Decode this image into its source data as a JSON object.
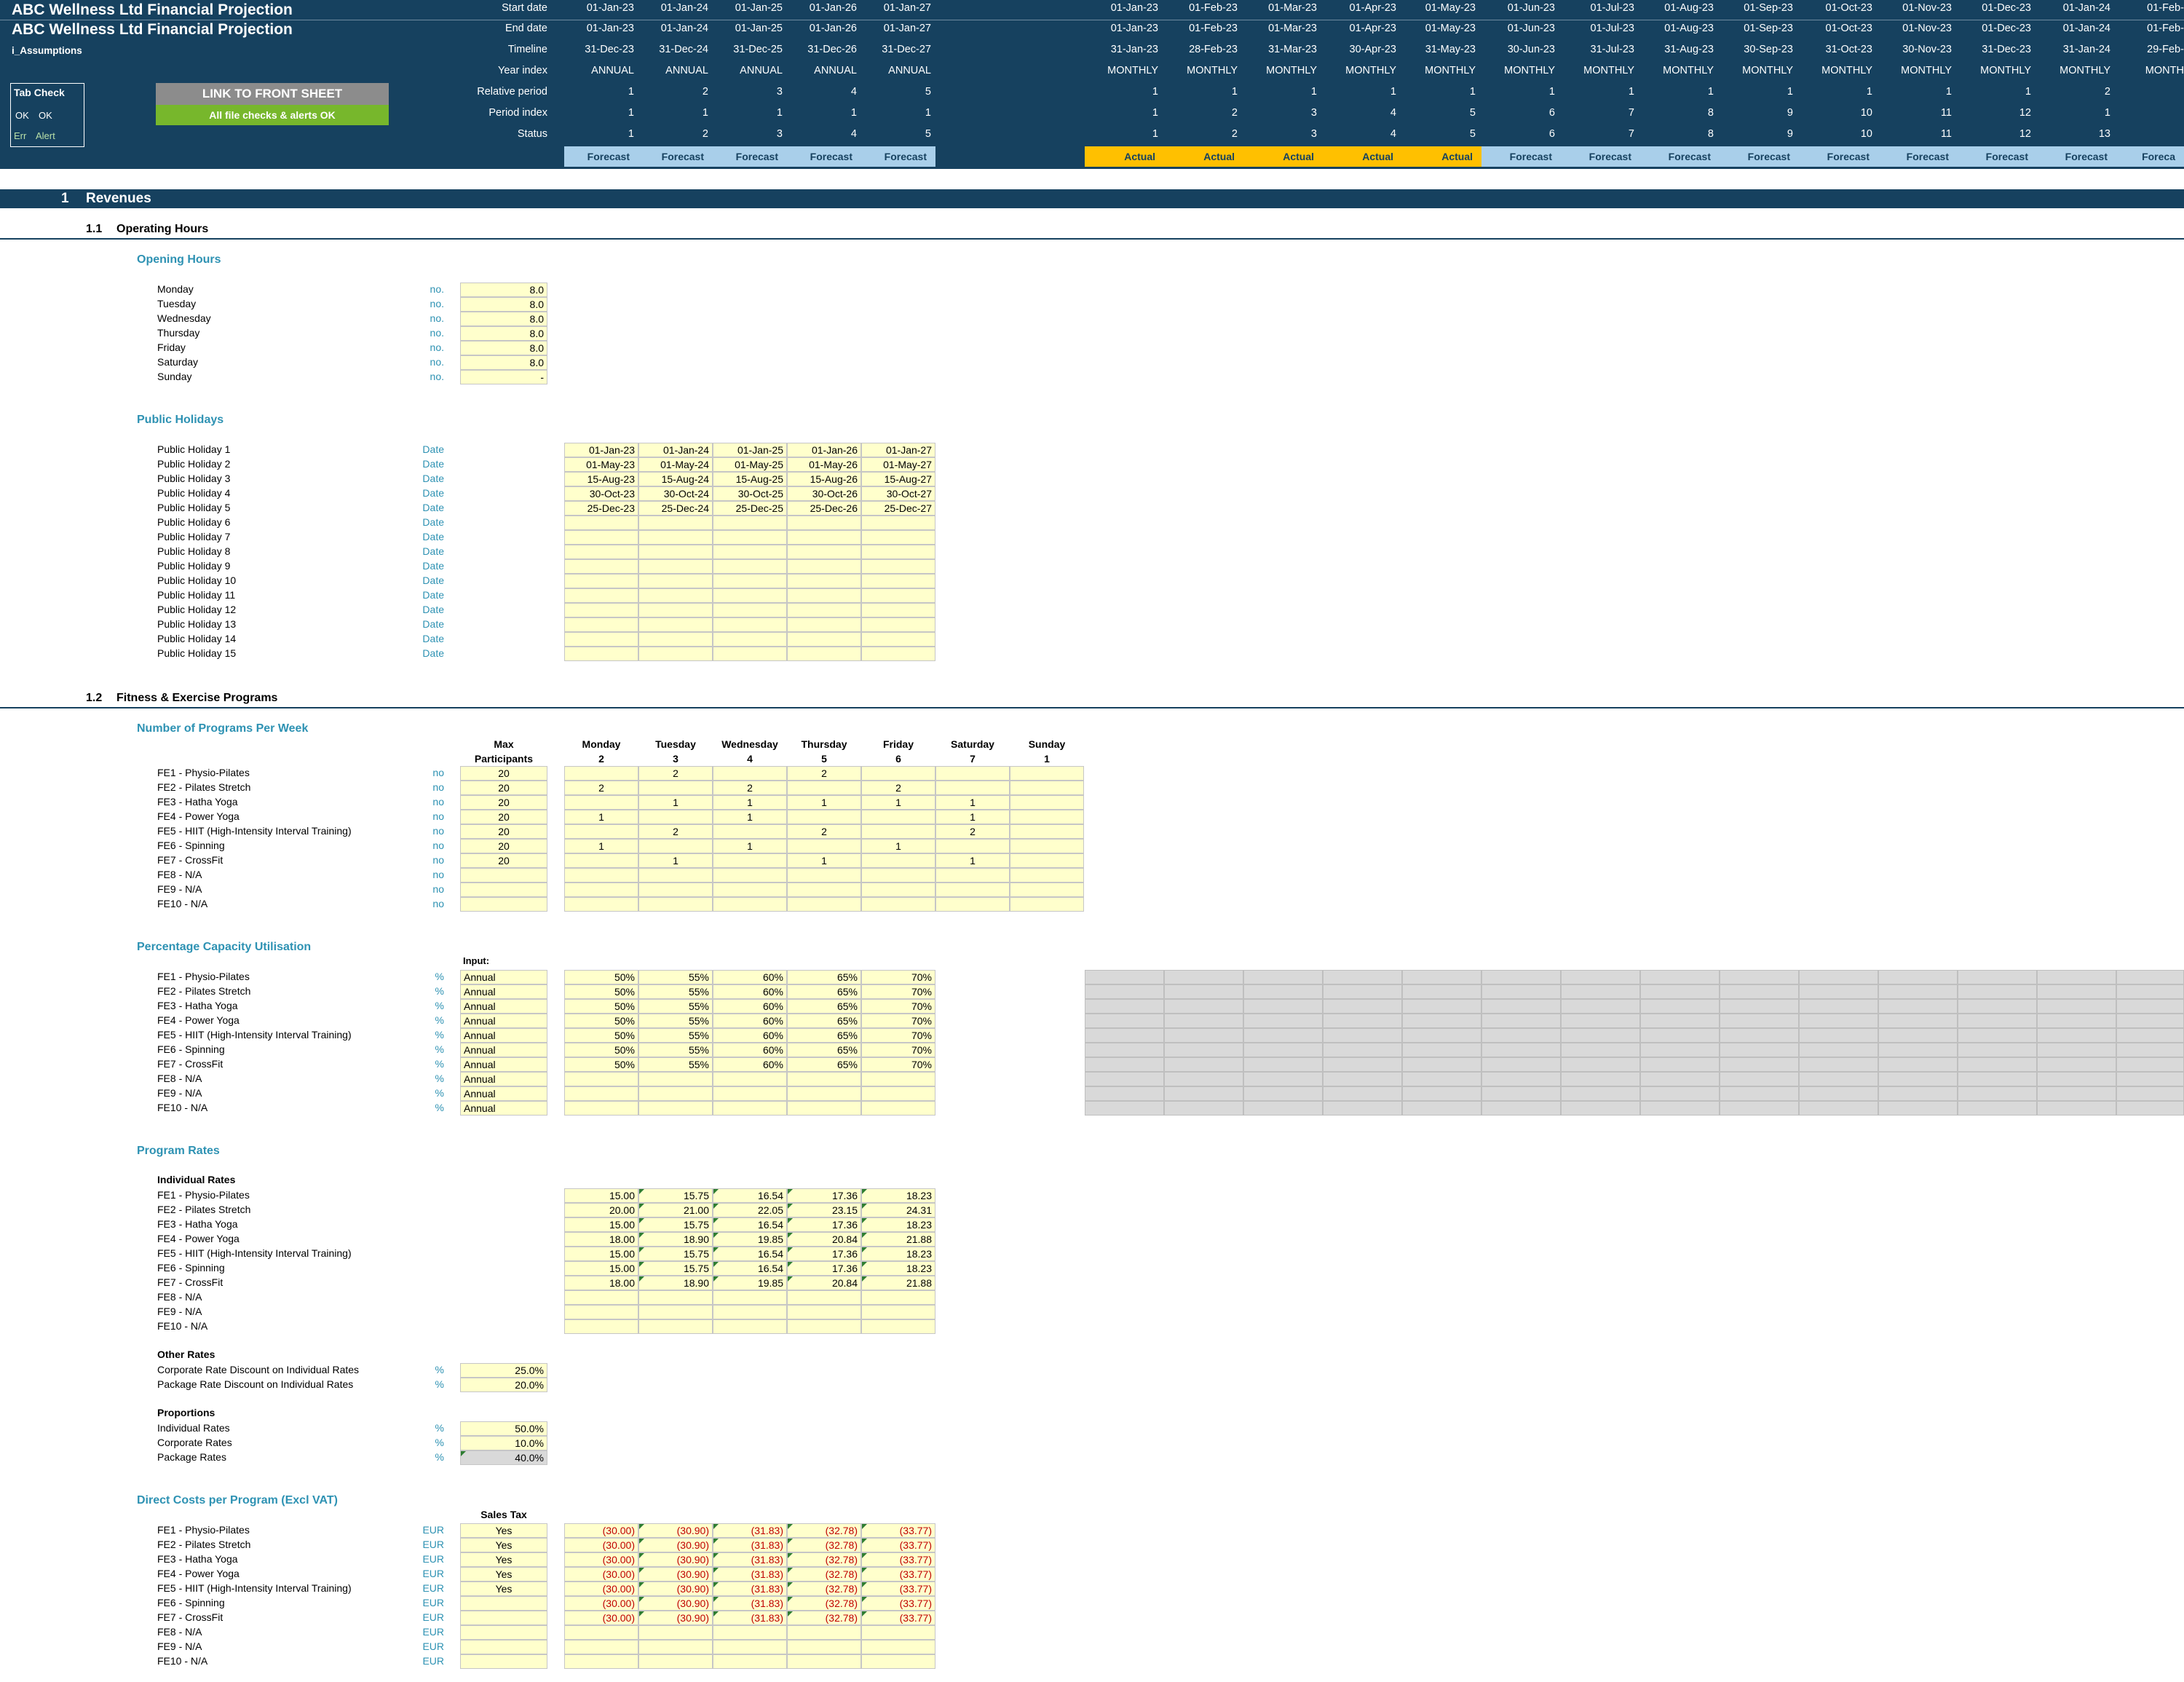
{
  "header": {
    "title": "ABC Wellness Ltd Financial Projection",
    "sheet": "i_Assumptions",
    "row_labels": [
      "Start date",
      "End date",
      "Timeline",
      "Year index",
      "Relative period",
      "Period index",
      "Status"
    ],
    "link_button": "LINK TO FRONT SHEET",
    "checks_banner": "All file checks & alerts OK",
    "tab_check": {
      "title": "Tab Check",
      "ok1": "OK",
      "ok2": "OK",
      "err": "Err",
      "alert": "Alert"
    },
    "annual": {
      "start_dates": [
        "01-Jan-23",
        "01-Jan-24",
        "01-Jan-25",
        "01-Jan-26",
        "01-Jan-27"
      ],
      "end_dates": [
        "31-Dec-23",
        "31-Dec-24",
        "31-Dec-25",
        "31-Dec-26",
        "31-Dec-27"
      ],
      "timeline": [
        "ANNUAL",
        "ANNUAL",
        "ANNUAL",
        "ANNUAL",
        "ANNUAL"
      ],
      "year_index": [
        "1",
        "2",
        "3",
        "4",
        "5"
      ],
      "relative_period": [
        "1",
        "1",
        "1",
        "1",
        "1"
      ],
      "period_index": [
        "1",
        "2",
        "3",
        "4",
        "5"
      ],
      "status": [
        "Forecast",
        "Forecast",
        "Forecast",
        "Forecast",
        "Forecast"
      ]
    },
    "monthly": {
      "start_dates": [
        "01-Jan-23",
        "01-Feb-23",
        "01-Mar-23",
        "01-Apr-23",
        "01-May-23",
        "01-Jun-23",
        "01-Jul-23",
        "01-Aug-23",
        "01-Sep-23",
        "01-Oct-23",
        "01-Nov-23",
        "01-Dec-23",
        "01-Jan-24",
        "01-Feb-2"
      ],
      "end_dates": [
        "31-Jan-23",
        "28-Feb-23",
        "31-Mar-23",
        "30-Apr-23",
        "31-May-23",
        "30-Jun-23",
        "31-Jul-23",
        "31-Aug-23",
        "30-Sep-23",
        "31-Oct-23",
        "30-Nov-23",
        "31-Dec-23",
        "31-Jan-24",
        "29-Feb-2"
      ],
      "timeline": [
        "MONTHLY",
        "MONTHLY",
        "MONTHLY",
        "MONTHLY",
        "MONTHLY",
        "MONTHLY",
        "MONTHLY",
        "MONTHLY",
        "MONTHLY",
        "MONTHLY",
        "MONTHLY",
        "MONTHLY",
        "MONTHLY",
        "MONTHL"
      ],
      "year_index": [
        "1",
        "1",
        "1",
        "1",
        "1",
        "1",
        "1",
        "1",
        "1",
        "1",
        "1",
        "1",
        "2",
        ""
      ],
      "relative_period": [
        "1",
        "2",
        "3",
        "4",
        "5",
        "6",
        "7",
        "8",
        "9",
        "10",
        "11",
        "12",
        "1",
        ""
      ],
      "period_index": [
        "1",
        "2",
        "3",
        "4",
        "5",
        "6",
        "7",
        "8",
        "9",
        "10",
        "11",
        "12",
        "13",
        ""
      ],
      "status": [
        "Actual",
        "Actual",
        "Actual",
        "Actual",
        "Actual",
        "Forecast",
        "Forecast",
        "Forecast",
        "Forecast",
        "Forecast",
        "Forecast",
        "Forecast",
        "Forecast",
        "Foreca"
      ]
    }
  },
  "section": {
    "number": "1",
    "title": "Revenues"
  },
  "operating_hours": {
    "number": "1.1",
    "title": "Operating Hours",
    "opening_hours": {
      "title": "Opening Hours",
      "rows": [
        {
          "label": "Monday",
          "unit": "no.",
          "value": "8.0"
        },
        {
          "label": "Tuesday",
          "unit": "no.",
          "value": "8.0"
        },
        {
          "label": "Wednesday",
          "unit": "no.",
          "value": "8.0"
        },
        {
          "label": "Thursday",
          "unit": "no.",
          "value": "8.0"
        },
        {
          "label": "Friday",
          "unit": "no.",
          "value": "8.0"
        },
        {
          "label": "Saturday",
          "unit": "no.",
          "value": "8.0"
        },
        {
          "label": "Sunday",
          "unit": "no.",
          "value": "-"
        }
      ]
    },
    "public_holidays": {
      "title": "Public Holidays",
      "unit": "Date",
      "rows": [
        {
          "label": "Public Holiday 1",
          "values": [
            "01-Jan-23",
            "01-Jan-24",
            "01-Jan-25",
            "01-Jan-26",
            "01-Jan-27"
          ]
        },
        {
          "label": "Public Holiday 2",
          "values": [
            "01-May-23",
            "01-May-24",
            "01-May-25",
            "01-May-26",
            "01-May-27"
          ]
        },
        {
          "label": "Public Holiday 3",
          "values": [
            "15-Aug-23",
            "15-Aug-24",
            "15-Aug-25",
            "15-Aug-26",
            "15-Aug-27"
          ]
        },
        {
          "label": "Public Holiday 4",
          "values": [
            "30-Oct-23",
            "30-Oct-24",
            "30-Oct-25",
            "30-Oct-26",
            "30-Oct-27"
          ]
        },
        {
          "label": "Public Holiday 5",
          "values": [
            "25-Dec-23",
            "25-Dec-24",
            "25-Dec-25",
            "25-Dec-26",
            "25-Dec-27"
          ]
        },
        {
          "label": "Public Holiday 6",
          "values": [
            "",
            "",
            "",
            "",
            ""
          ]
        },
        {
          "label": "Public Holiday 7",
          "values": [
            "",
            "",
            "",
            "",
            ""
          ]
        },
        {
          "label": "Public Holiday 8",
          "values": [
            "",
            "",
            "",
            "",
            ""
          ]
        },
        {
          "label": "Public Holiday 9",
          "values": [
            "",
            "",
            "",
            "",
            ""
          ]
        },
        {
          "label": "Public Holiday 10",
          "values": [
            "",
            "",
            "",
            "",
            ""
          ]
        },
        {
          "label": "Public Holiday 11",
          "values": [
            "",
            "",
            "",
            "",
            ""
          ]
        },
        {
          "label": "Public Holiday 12",
          "values": [
            "",
            "",
            "",
            "",
            ""
          ]
        },
        {
          "label": "Public Holiday 13",
          "values": [
            "",
            "",
            "",
            "",
            ""
          ]
        },
        {
          "label": "Public Holiday 14",
          "values": [
            "",
            "",
            "",
            "",
            ""
          ]
        },
        {
          "label": "Public Holiday 15",
          "values": [
            "",
            "",
            "",
            "",
            ""
          ]
        }
      ]
    }
  },
  "fitness": {
    "number": "1.2",
    "title": "Fitness & Exercise Programs",
    "programs_per_week": {
      "title": "Number of Programs Per Week",
      "max_header": [
        "Max",
        "Participants"
      ],
      "days": [
        {
          "name": "Monday",
          "num": "2"
        },
        {
          "name": "Tuesday",
          "num": "3"
        },
        {
          "name": "Wednesday",
          "num": "4"
        },
        {
          "name": "Thursday",
          "num": "5"
        },
        {
          "name": "Friday",
          "num": "6"
        },
        {
          "name": "Saturday",
          "num": "7"
        },
        {
          "name": "Sunday",
          "num": "1"
        }
      ],
      "rows": [
        {
          "label": "FE1 - Physio-Pilates",
          "unit": "no",
          "max": "20",
          "values": [
            "",
            "2",
            "",
            "2",
            "",
            "",
            ""
          ]
        },
        {
          "label": "FE2 - Pilates Stretch",
          "unit": "no",
          "max": "20",
          "values": [
            "2",
            "",
            "2",
            "",
            "2",
            "",
            ""
          ]
        },
        {
          "label": "FE3 - Hatha Yoga",
          "unit": "no",
          "max": "20",
          "values": [
            "",
            "1",
            "1",
            "1",
            "1",
            "1",
            ""
          ]
        },
        {
          "label": "FE4 - Power Yoga",
          "unit": "no",
          "max": "20",
          "values": [
            "1",
            "",
            "1",
            "",
            "",
            "1",
            ""
          ]
        },
        {
          "label": "FE5 - HIIT (High-Intensity Interval Training)",
          "unit": "no",
          "max": "20",
          "values": [
            "",
            "2",
            "",
            "2",
            "",
            "2",
            ""
          ]
        },
        {
          "label": "FE6 - Spinning",
          "unit": "no",
          "max": "20",
          "values": [
            "1",
            "",
            "1",
            "",
            "1",
            "",
            ""
          ]
        },
        {
          "label": "FE7 - CrossFit",
          "unit": "no",
          "max": "20",
          "values": [
            "",
            "1",
            "",
            "1",
            "",
            "1",
            ""
          ]
        },
        {
          "label": "FE8 - N/A",
          "unit": "no",
          "max": "",
          "values": [
            "",
            "",
            "",
            "",
            "",
            "",
            ""
          ]
        },
        {
          "label": "FE9 - N/A",
          "unit": "no",
          "max": "",
          "values": [
            "",
            "",
            "",
            "",
            "",
            "",
            ""
          ]
        },
        {
          "label": "FE10 - N/A",
          "unit": "no",
          "max": "",
          "values": [
            "",
            "",
            "",
            "",
            "",
            "",
            ""
          ]
        }
      ]
    },
    "capacity": {
      "title": "Percentage Capacity Utilisation",
      "input_header": "Input:",
      "rows": [
        {
          "label": "FE1 - Physio-Pilates",
          "unit": "%",
          "input": "Annual",
          "values": [
            "50%",
            "55%",
            "60%",
            "65%",
            "70%"
          ]
        },
        {
          "label": "FE2 - Pilates Stretch",
          "unit": "%",
          "input": "Annual",
          "values": [
            "50%",
            "55%",
            "60%",
            "65%",
            "70%"
          ]
        },
        {
          "label": "FE3 - Hatha Yoga",
          "unit": "%",
          "input": "Annual",
          "values": [
            "50%",
            "55%",
            "60%",
            "65%",
            "70%"
          ]
        },
        {
          "label": "FE4 - Power Yoga",
          "unit": "%",
          "input": "Annual",
          "values": [
            "50%",
            "55%",
            "60%",
            "65%",
            "70%"
          ]
        },
        {
          "label": "FE5 - HIIT (High-Intensity Interval Training)",
          "unit": "%",
          "input": "Annual",
          "values": [
            "50%",
            "55%",
            "60%",
            "65%",
            "70%"
          ]
        },
        {
          "label": "FE6 - Spinning",
          "unit": "%",
          "input": "Annual",
          "values": [
            "50%",
            "55%",
            "60%",
            "65%",
            "70%"
          ]
        },
        {
          "label": "FE7 - CrossFit",
          "unit": "%",
          "input": "Annual",
          "values": [
            "50%",
            "55%",
            "60%",
            "65%",
            "70%"
          ]
        },
        {
          "label": "FE8 - N/A",
          "unit": "%",
          "input": "Annual",
          "values": [
            "",
            "",
            "",
            "",
            ""
          ]
        },
        {
          "label": "FE9 - N/A",
          "unit": "%",
          "input": "Annual",
          "values": [
            "",
            "",
            "",
            "",
            ""
          ]
        },
        {
          "label": "FE10 - N/A",
          "unit": "%",
          "input": "Annual",
          "values": [
            "",
            "",
            "",
            "",
            ""
          ]
        }
      ]
    },
    "rates": {
      "title": "Program Rates",
      "individual_title": "Individual Rates",
      "rows": [
        {
          "label": "FE1 - Physio-Pilates",
          "values": [
            "15.00",
            "15.75",
            "16.54",
            "17.36",
            "18.23"
          ]
        },
        {
          "label": "FE2 - Pilates Stretch",
          "values": [
            "20.00",
            "21.00",
            "22.05",
            "23.15",
            "24.31"
          ]
        },
        {
          "label": "FE3 - Hatha Yoga",
          "values": [
            "15.00",
            "15.75",
            "16.54",
            "17.36",
            "18.23"
          ]
        },
        {
          "label": "FE4 - Power Yoga",
          "values": [
            "18.00",
            "18.90",
            "19.85",
            "20.84",
            "21.88"
          ]
        },
        {
          "label": "FE5 - HIIT (High-Intensity Interval Training)",
          "values": [
            "15.00",
            "15.75",
            "16.54",
            "17.36",
            "18.23"
          ]
        },
        {
          "label": "FE6 - Spinning",
          "values": [
            "15.00",
            "15.75",
            "16.54",
            "17.36",
            "18.23"
          ]
        },
        {
          "label": "FE7 - CrossFit",
          "values": [
            "18.00",
            "18.90",
            "19.85",
            "20.84",
            "21.88"
          ]
        },
        {
          "label": "FE8 - N/A",
          "values": [
            "",
            "",
            "",
            "",
            ""
          ]
        },
        {
          "label": "FE9 - N/A",
          "values": [
            "",
            "",
            "",
            "",
            ""
          ]
        },
        {
          "label": "FE10 - N/A",
          "values": [
            "",
            "",
            "",
            "",
            ""
          ]
        }
      ],
      "other_title": "Other Rates",
      "other": [
        {
          "label": "Corporate Rate Discount on Individual Rates",
          "unit": "%",
          "value": "25.0%"
        },
        {
          "label": "Package Rate Discount on Individual Rates",
          "unit": "%",
          "value": "20.0%"
        }
      ],
      "proportions_title": "Proportions",
      "proportions": [
        {
          "label": "Individual Rates",
          "unit": "%",
          "value": "50.0%"
        },
        {
          "label": "Corporate Rates",
          "unit": "%",
          "value": "10.0%"
        },
        {
          "label": "Package Rates",
          "unit": "%",
          "value": "40.0%"
        }
      ]
    },
    "direct_costs": {
      "title": "Direct Costs per Program (Excl VAT)",
      "tax_header": "Sales Tax",
      "rows": [
        {
          "label": "FE1 - Physio-Pilates",
          "unit": "EUR",
          "tax": "Yes",
          "values": [
            "(30.00)",
            "(30.90)",
            "(31.83)",
            "(32.78)",
            "(33.77)"
          ]
        },
        {
          "label": "FE2 - Pilates Stretch",
          "unit": "EUR",
          "tax": "Yes",
          "values": [
            "(30.00)",
            "(30.90)",
            "(31.83)",
            "(32.78)",
            "(33.77)"
          ]
        },
        {
          "label": "FE3 - Hatha Yoga",
          "unit": "EUR",
          "tax": "Yes",
          "values": [
            "(30.00)",
            "(30.90)",
            "(31.83)",
            "(32.78)",
            "(33.77)"
          ]
        },
        {
          "label": "FE4 - Power Yoga",
          "unit": "EUR",
          "tax": "Yes",
          "values": [
            "(30.00)",
            "(30.90)",
            "(31.83)",
            "(32.78)",
            "(33.77)"
          ]
        },
        {
          "label": "FE5 - HIIT (High-Intensity Interval Training)",
          "unit": "EUR",
          "tax": "Yes",
          "values": [
            "(30.00)",
            "(30.90)",
            "(31.83)",
            "(32.78)",
            "(33.77)"
          ]
        },
        {
          "label": "FE6 - Spinning",
          "unit": "EUR",
          "tax": "",
          "values": [
            "(30.00)",
            "(30.90)",
            "(31.83)",
            "(32.78)",
            "(33.77)"
          ]
        },
        {
          "label": "FE7 - CrossFit",
          "unit": "EUR",
          "tax": "",
          "values": [
            "(30.00)",
            "(30.90)",
            "(31.83)",
            "(32.78)",
            "(33.77)"
          ]
        },
        {
          "label": "FE8 - N/A",
          "unit": "EUR",
          "tax": "",
          "values": [
            "",
            "",
            "",
            "",
            ""
          ]
        },
        {
          "label": "FE9 - N/A",
          "unit": "EUR",
          "tax": "",
          "values": [
            "",
            "",
            "",
            "",
            ""
          ]
        },
        {
          "label": "FE10 - N/A",
          "unit": "EUR",
          "tax": "",
          "values": [
            "",
            "",
            "",
            "",
            ""
          ]
        }
      ]
    }
  }
}
